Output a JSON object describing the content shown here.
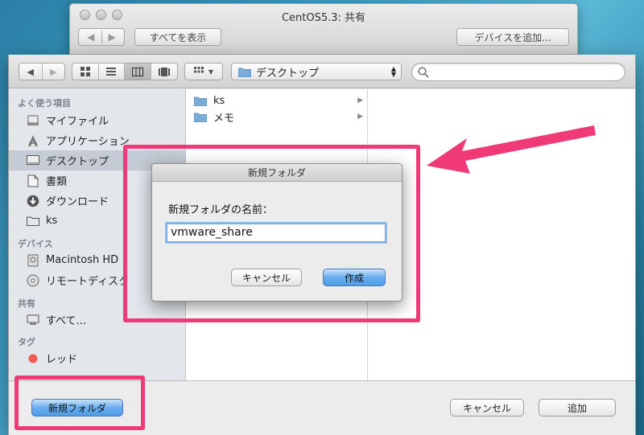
{
  "bg_window": {
    "title": "CentOS5.3: 共有",
    "show_all_label": "すべてを表示",
    "add_device_label": "デバイスを追加..."
  },
  "toolbar": {
    "path_label": "デスクトップ",
    "search_placeholder": ""
  },
  "sidebar": {
    "favorites_header": "よく使う項目",
    "favorites": [
      {
        "label": "マイファイル",
        "icon": "all-files-icon"
      },
      {
        "label": "アプリケーション",
        "icon": "applications-icon"
      },
      {
        "label": "デスクトップ",
        "icon": "desktop-icon",
        "selected": true
      },
      {
        "label": "書類",
        "icon": "documents-icon"
      },
      {
        "label": "ダウンロード",
        "icon": "downloads-icon"
      },
      {
        "label": "ks",
        "icon": "folder-icon"
      }
    ],
    "devices_header": "デバイス",
    "devices": [
      {
        "label": "Macintosh HD",
        "icon": "hard-disk-icon"
      },
      {
        "label": "リモートディスク",
        "icon": "remote-disc-icon"
      }
    ],
    "shared_header": "共有",
    "shared": [
      {
        "label": "すべて...",
        "icon": "network-icon"
      }
    ],
    "tags_header": "タグ",
    "tags": [
      {
        "label": "レッド",
        "color": "#f25c54"
      }
    ]
  },
  "column1": {
    "items": [
      {
        "label": "ks",
        "icon": "folder-icon"
      },
      {
        "label": "メモ",
        "icon": "folder-icon"
      }
    ]
  },
  "bottom": {
    "new_folder_label": "新規フォルダ",
    "cancel_label": "キャンセル",
    "add_label": "追加"
  },
  "dialog": {
    "title": "新規フォルダ",
    "name_label": "新規フォルダの名前：",
    "name_value": "vmware_share",
    "cancel_label": "キャンセル",
    "create_label": "作成"
  },
  "colors": {
    "highlight": "#f03a78",
    "accent": "#4e9be8"
  }
}
